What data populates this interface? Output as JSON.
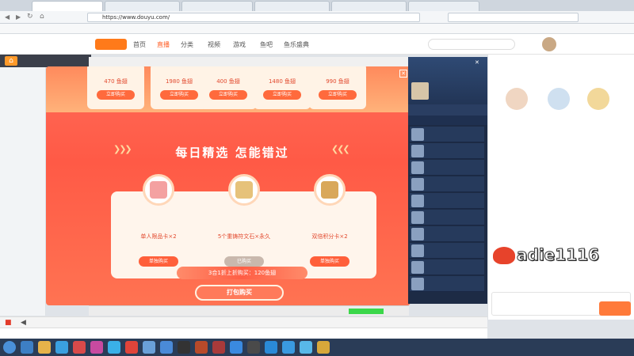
{
  "browser": {
    "tabs": [
      {
        "label": ""
      },
      {
        "label": ""
      },
      {
        "label": ""
      },
      {
        "label": ""
      },
      {
        "label": ""
      },
      {
        "label": ""
      }
    ],
    "url": "https://www.douyu.com/",
    "search_placeholder": ""
  },
  "bookmarks": [],
  "site_nav": {
    "items": [
      "首页",
      "直播",
      "分类",
      "视频",
      "游戏",
      "鱼吧",
      "鱼乐盛典"
    ],
    "active_index": 1
  },
  "room": {
    "host_name": "",
    "room_id": "",
    "sidebar_lines": []
  },
  "modal": {
    "top_prices": [
      "470 鱼翅",
      "1980 鱼翅",
      "400 鱼翅",
      "1480 鱼翅",
      "990 鱼翅"
    ],
    "top_button_label": "立即购买",
    "title": "每日精选 怎能错过",
    "subtitle": "",
    "products": [
      {
        "name": "单人限品卡×2",
        "price": "",
        "button": "单独购买",
        "disabled": false,
        "color": "#f4a1a1"
      },
      {
        "name": "5个重铸符文石×永久",
        "price": "",
        "button": "已购买",
        "disabled": true,
        "color": "#e6c27a"
      },
      {
        "name": "双倍积分卡×2",
        "price": "",
        "button": "单独购买",
        "disabled": false,
        "color": "#d9a85a"
      }
    ],
    "bundle_banner": "3合1折上折购买：120鱼翅",
    "bundle_button": "打包购买"
  },
  "game_sidebar": {
    "player_name": "",
    "top_buttons": [],
    "tabs": [],
    "sub_header": "",
    "rows": [
      "",
      "",
      "",
      "",
      "",
      "",
      "",
      "",
      "",
      "",
      "",
      "",
      ""
    ]
  },
  "chat": {
    "tabs": [],
    "lines": [
      {
        "nick": "",
        "text": ""
      },
      {
        "nick": "",
        "text": ""
      },
      {
        "nick": "",
        "text": ""
      },
      {
        "nick": "",
        "text": ""
      },
      {
        "nick": "",
        "text": ""
      },
      {
        "nick": "",
        "text": ""
      },
      {
        "nick": "",
        "text": ""
      },
      {
        "nick": "",
        "text": ""
      },
      {
        "nick": "",
        "text": ""
      },
      {
        "nick": "",
        "text": ""
      },
      {
        "nick": "",
        "text": ""
      },
      {
        "nick": "",
        "text": ""
      },
      {
        "nick": "",
        "text": ""
      },
      {
        "nick": "",
        "text": ""
      },
      {
        "nick": "",
        "text": ""
      }
    ]
  },
  "watermark": "adie1116",
  "stream_info": "",
  "player_bar": "",
  "notice": "",
  "clock": {
    "time": "",
    "date": ""
  },
  "colors": {
    "accent": "#ff5d23",
    "modal_bg": "#ff5a46",
    "sidebar_bg": "#1d2b45"
  }
}
